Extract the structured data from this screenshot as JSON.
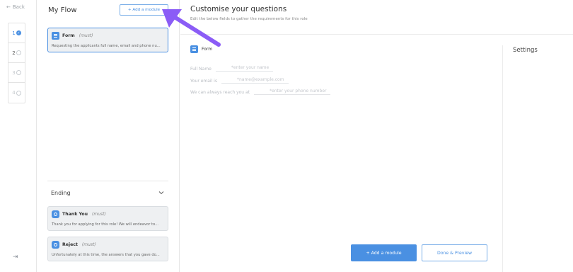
{
  "rail": {
    "back_label": "Back",
    "steps": [
      {
        "num": "1",
        "state": "done"
      },
      {
        "num": "2",
        "state": "active"
      },
      {
        "num": "3",
        "state": "pending"
      },
      {
        "num": "4",
        "state": "pending"
      }
    ]
  },
  "flow": {
    "title": "My Flow",
    "add_button": "+ Add a module",
    "modules": [
      {
        "name": "Form",
        "tag": "(must)",
        "desc": "Requesting the applicants full name, email and phone nu..."
      }
    ],
    "ending_label": "Ending",
    "ending_modules": [
      {
        "name": "Thank You",
        "tag": "(must)",
        "desc": "Thank you for applying for this role! We will endeavor to..."
      },
      {
        "name": "Reject",
        "tag": "(must)",
        "desc": "Unfortunately at this time, the answers that you gave do..."
      }
    ]
  },
  "main": {
    "title": "Customise your questions",
    "subtitle": "Edit the below fields to gather the requirements for this role",
    "form_label": "Form",
    "fields": [
      {
        "label": "Full Name",
        "placeholder": "*enter your name"
      },
      {
        "label": "Your email is",
        "placeholder": "*name@example.com"
      },
      {
        "label": "We can always reach you at",
        "placeholder": "*enter your phone number"
      }
    ],
    "settings_label": "Settings",
    "add_button": "+ Add a module",
    "done_button": "Done & Preview"
  },
  "colors": {
    "accent": "#4a90e2",
    "annotation": "#8b5cf6"
  }
}
